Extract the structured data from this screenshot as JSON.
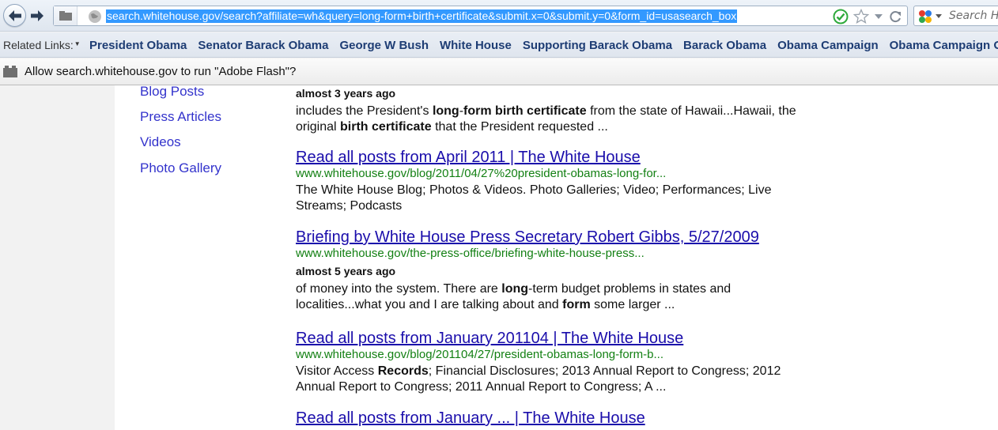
{
  "browser": {
    "url": "search.whitehouse.gov/search?affiliate=wh&query=long-form+birth+certificate&submit.x=0&submit.y=0&form_id=usasearch_box",
    "search_placeholder": "Search He"
  },
  "related_links": {
    "label": "Related Links:",
    "items": [
      "President Obama",
      "Senator Barack Obama",
      "George W Bush",
      "White House",
      "Supporting Barack Obama",
      "Barack Obama",
      "Obama Campaign",
      "Obama Campaign Office"
    ]
  },
  "notification": {
    "text": "Allow search.whitehouse.gov to run \"Adobe Flash\"?"
  },
  "sidebar": {
    "items": [
      "Blog Posts",
      "Press Articles",
      "Videos",
      "Photo Gallery"
    ]
  },
  "results": [
    {
      "date": "almost 3 years ago",
      "snippet_parts": [
        [
          "includes the President's ",
          false
        ],
        [
          "long",
          true
        ],
        [
          "-",
          false
        ],
        [
          "form",
          true
        ],
        [
          " ",
          false
        ],
        [
          "birth certificate",
          true
        ],
        [
          " from the state of Hawaii...Hawaii, the original ",
          false
        ],
        [
          "birth certificate",
          true
        ],
        [
          " that the President requested ...",
          false
        ]
      ]
    },
    {
      "title": "Read all posts from April 2011 | The White House",
      "url": "www.whitehouse.gov/blog/2011/04/27%20president-obamas-long-for...",
      "snippet_parts": [
        [
          "The White House Blog; Photos & Videos. Photo Galleries; Video; Performances; Live Streams; Podcasts",
          false
        ]
      ]
    },
    {
      "title": "Briefing by White House Press Secretary Robert Gibbs, 5/27/2009",
      "url": "www.whitehouse.gov/the-press-office/briefing-white-house-press...",
      "date": "almost 5 years ago",
      "snippet_parts": [
        [
          "of money into the system.  There are ",
          false
        ],
        [
          "long",
          true
        ],
        [
          "-term budget problems in states and localities...what you and I are talking about and ",
          false
        ],
        [
          "form",
          true
        ],
        [
          " some larger ...",
          false
        ]
      ]
    },
    {
      "title": "Read all posts from January 201104 | The White House",
      "url": "www.whitehouse.gov/blog/201104/27/president-obamas-long-form-b...",
      "snippet_parts": [
        [
          "Visitor Access ",
          false
        ],
        [
          "Records",
          true
        ],
        [
          "; Financial Disclosures; 2013 Annual Report to Congress; 2012 Annual Report to Congress; 2011 Annual Report to Congress; A ...",
          false
        ]
      ]
    },
    {
      "title": "Read all posts from January ... | The White House"
    }
  ],
  "colors": {
    "link": "#1a0dab",
    "url_green": "#138013",
    "sidebar_link": "#3333cc",
    "related_link": "#1e3d74",
    "url_highlight": "#3399ff"
  },
  "icons": {
    "back": "back-arrow-icon",
    "forward": "forward-arrow-icon",
    "identity": "site-identity-icon",
    "site": "globe-icon",
    "verified": "check-circle-icon",
    "bookmark": "star-icon",
    "history": "dropdown-arrow-icon",
    "reload": "reload-icon",
    "engine": "search-engine-icon",
    "plugin": "plugin-icon"
  }
}
